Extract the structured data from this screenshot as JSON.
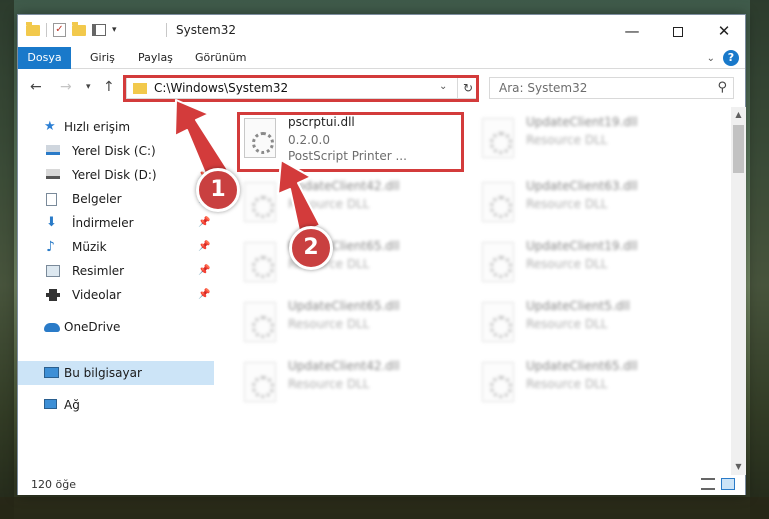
{
  "window": {
    "title": "System32"
  },
  "ribbon": {
    "tabs": [
      "Dosya",
      "Giriş",
      "Paylaş",
      "Görünüm"
    ]
  },
  "nav": {
    "address": "C:\\Windows\\System32",
    "search_placeholder": "Ara: System32"
  },
  "sidebar": {
    "items": [
      {
        "label": "Hızlı erişim",
        "icon": "star-icon"
      },
      {
        "label": "Yerel Disk (C:)",
        "icon": "drive-icon"
      },
      {
        "label": "Yerel Disk (D:)",
        "icon": "drive-icon"
      },
      {
        "label": "Belgeler",
        "icon": "documents-icon"
      },
      {
        "label": "İndirmeler",
        "icon": "download-icon"
      },
      {
        "label": "Müzik",
        "icon": "music-icon"
      },
      {
        "label": "Resimler",
        "icon": "pictures-icon"
      },
      {
        "label": "Videolar",
        "icon": "videos-icon"
      },
      {
        "label": "OneDrive",
        "icon": "cloud-icon"
      },
      {
        "label": "Bu bilgisayar",
        "icon": "computer-icon"
      },
      {
        "label": "Ağ",
        "icon": "network-icon"
      }
    ]
  },
  "files": {
    "main": {
      "name": "pscrptui.dll",
      "version": "0.2.0.0",
      "description": "PostScript Printer ..."
    },
    "left_column": [
      {
        "name": "UpdateClient42.dll",
        "type": "Resource DLL"
      },
      {
        "name": "UpdateClient65.dll",
        "type": "Resource DLL"
      },
      {
        "name": "UpdateClient65.dll",
        "type": "Resource DLL"
      },
      {
        "name": "UpdateClient42.dll",
        "type": "Resource DLL"
      }
    ],
    "right_column": [
      {
        "name": "UpdateClient19.dll",
        "type": "Resource DLL"
      },
      {
        "name": "UpdateClient63.dll",
        "type": "Resource DLL"
      },
      {
        "name": "UpdateClient19.dll",
        "type": "Resource DLL"
      },
      {
        "name": "UpdateClient5.dll",
        "type": "Resource DLL"
      },
      {
        "name": "UpdateClient65.dll",
        "type": "Resource DLL"
      }
    ]
  },
  "status": {
    "count": "120 öğe"
  },
  "annotations": {
    "step1": "1",
    "step2": "2",
    "color": "#d33b3b"
  }
}
